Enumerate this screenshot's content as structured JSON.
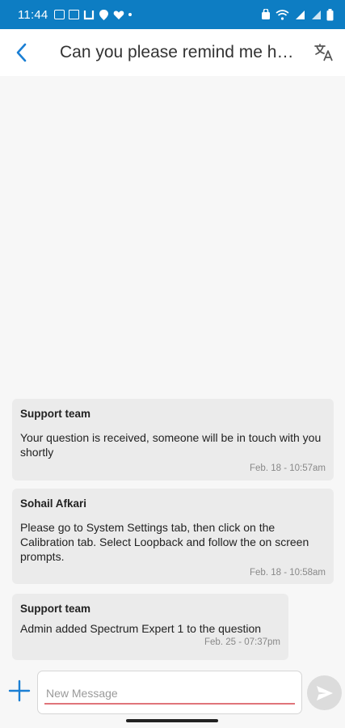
{
  "status_bar": {
    "time": "11:44",
    "left_icons": [
      "gallery-icon",
      "calendar-icon",
      "app-icon",
      "location-icon",
      "heart-icon",
      "dot-icon"
    ],
    "right_icons": [
      "alarm-icon",
      "wifi-icon",
      "signal-icon",
      "signal-icon",
      "battery-icon"
    ]
  },
  "header": {
    "title": "Can you please remind me ho...",
    "back_icon": "chevron-left-icon",
    "translate_icon": "translate-icon"
  },
  "messages": [
    {
      "sender": "Support team",
      "text": "Your question is received, someone will be in touch with you shortly",
      "timestamp": "Feb. 18 - 10:57am"
    },
    {
      "sender": "Sohail Afkari",
      "text": "Please go to System Settings tab, then click on the Calibration tab. Select Loopback and follow the on screen prompts.",
      "timestamp": "Feb. 18 - 10:58am"
    },
    {
      "sender": "Support team",
      "text": "Admin added Spectrum Expert 1 to the question",
      "timestamp": "Feb. 25 - 07:37pm"
    }
  ],
  "composer": {
    "placeholder": "New Message",
    "value": "",
    "add_icon": "plus-icon",
    "send_icon": "send-icon"
  },
  "colors": {
    "status_bar": "#0d7dc3",
    "accent": "#1a7fd4",
    "bubble": "#ebebeb",
    "input_underline": "#e0747a"
  }
}
